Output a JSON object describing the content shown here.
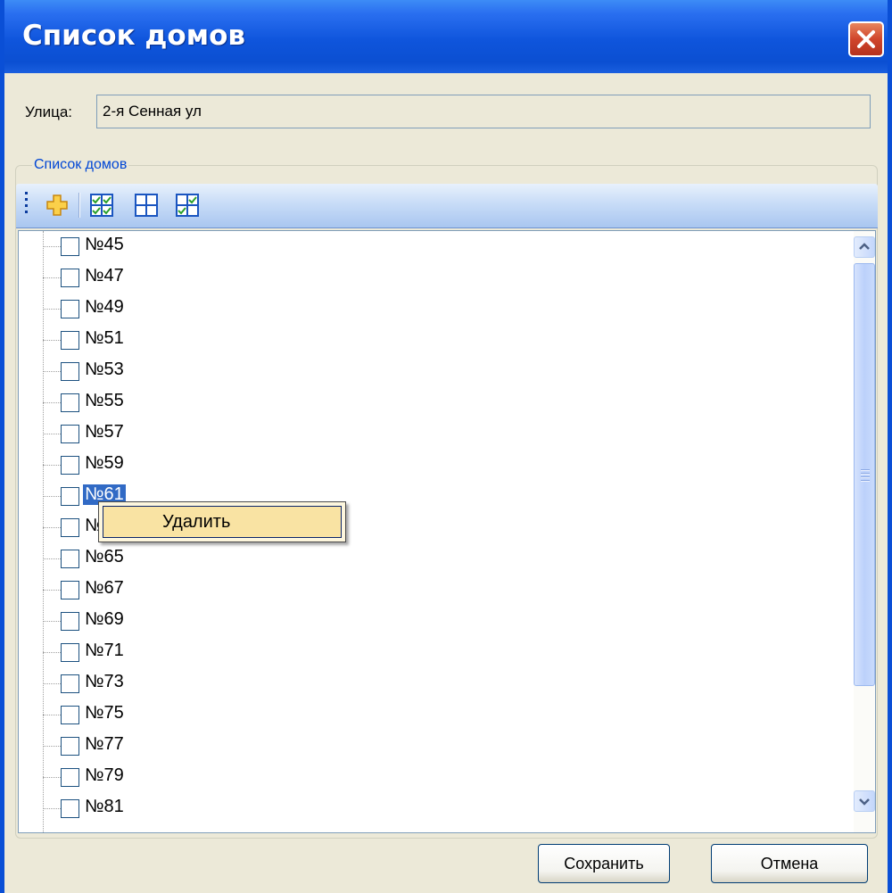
{
  "window": {
    "title": "Список домов",
    "close_icon": "close-icon"
  },
  "street": {
    "label": "Улица:",
    "value": "2-я Сенная ул"
  },
  "group": {
    "legend": "Список домов"
  },
  "toolbar": {
    "icons": [
      "grip-icon",
      "add-plus-icon",
      "select-all-icon",
      "deselect-all-icon",
      "invert-selection-icon"
    ]
  },
  "tree": {
    "items": [
      {
        "label": "№45"
      },
      {
        "label": "№47"
      },
      {
        "label": "№49"
      },
      {
        "label": "№51"
      },
      {
        "label": "№53"
      },
      {
        "label": "№55"
      },
      {
        "label": "№57"
      },
      {
        "label": "№59"
      },
      {
        "label": "№61",
        "selected": true
      },
      {
        "label": "№63"
      },
      {
        "label": "№65"
      },
      {
        "label": "№67"
      },
      {
        "label": "№69"
      },
      {
        "label": "№71"
      },
      {
        "label": "№73"
      },
      {
        "label": "№75"
      },
      {
        "label": "№77"
      },
      {
        "label": "№79"
      },
      {
        "label": "№81"
      }
    ]
  },
  "context_menu": {
    "items": [
      {
        "label": "Удалить"
      }
    ]
  },
  "buttons": {
    "save": "Сохранить",
    "cancel": "Отмена"
  },
  "colors": {
    "title_bar": "#0b4fd2",
    "selection": "#316ac5",
    "menu_highlight": "#f9e3a3",
    "legend_text": "#0046d5"
  }
}
